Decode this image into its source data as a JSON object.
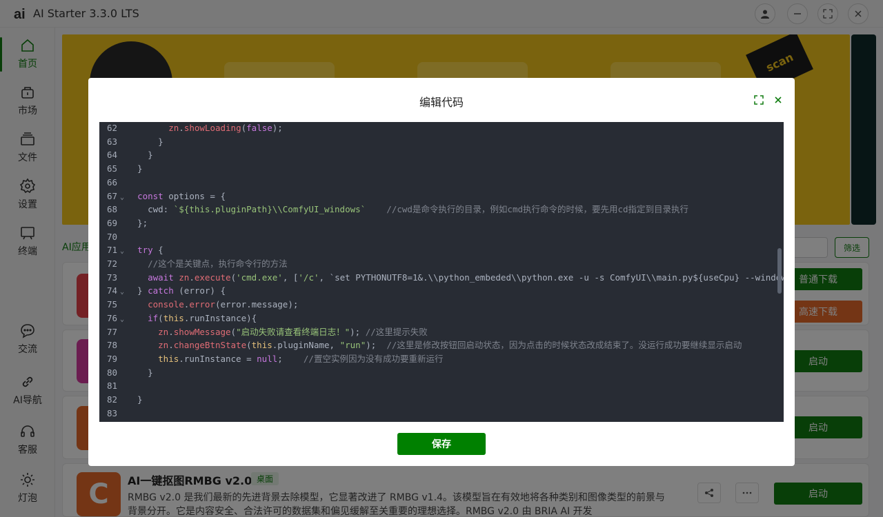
{
  "window": {
    "title": "AI Starter 3.3.0 LTS"
  },
  "sidebar": {
    "items": [
      {
        "label": "首页",
        "icon": "home-icon"
      },
      {
        "label": "市场",
        "icon": "market-icon"
      },
      {
        "label": "文件",
        "icon": "files-icon"
      },
      {
        "label": "设置",
        "icon": "gear-icon"
      },
      {
        "label": "终端",
        "icon": "terminal-icon"
      },
      {
        "label": "交流",
        "icon": "chat-icon"
      },
      {
        "label": "AI导航",
        "icon": "link-icon"
      },
      {
        "label": "客服",
        "icon": "headset-icon"
      },
      {
        "label": "灯泡",
        "icon": "bulb-icon"
      }
    ]
  },
  "main": {
    "banner": {
      "stamp": "scan"
    },
    "tab_label": "AI应用",
    "filter_label": "筛选",
    "buttons": {
      "normal_download": "普通下载",
      "fast_download": "高速下载",
      "start": "启动"
    },
    "app": {
      "name": "AI一键抠图RMBG v2.0",
      "tag": "桌面",
      "description": "RMBG v2.0 是我们最新的先进背景去除模型，它显著改进了 RMBG v1.4。该模型旨在有效地将各种类别和图像类型的前景与背景分开。它是内容安全、合法许可的数据集和偏见缓解至关重要的理想选择。RMBG v2.0 由 BRIA AI 开发",
      "thumb_letter": "C"
    }
  },
  "modal": {
    "title": "编辑代码",
    "save_label": "保存",
    "code_lines": [
      {
        "n": "62",
        "fold": "",
        "ind": "        ",
        "text": "zn.showLoading(false);"
      },
      {
        "n": "63",
        "fold": "",
        "ind": "      ",
        "text": "}"
      },
      {
        "n": "64",
        "fold": "",
        "ind": "    ",
        "text": "}"
      },
      {
        "n": "65",
        "fold": "",
        "ind": "  ",
        "text": "}"
      },
      {
        "n": "66",
        "fold": "",
        "ind": "",
        "text": ""
      },
      {
        "n": "67",
        "fold": "⌄",
        "ind": "  ",
        "text": "const options = {"
      },
      {
        "n": "68",
        "fold": "",
        "ind": "    ",
        "text": "cwd: `${this.pluginPath}\\\\ComfyUI_windows`    //cwd是命令执行的目录，例如cmd执行命令的时候，要先用cd指定到目录执行"
      },
      {
        "n": "69",
        "fold": "",
        "ind": "  ",
        "text": "};"
      },
      {
        "n": "70",
        "fold": "",
        "ind": "",
        "text": ""
      },
      {
        "n": "71",
        "fold": "⌄",
        "ind": "  ",
        "text": "try {"
      },
      {
        "n": "72",
        "fold": "",
        "ind": "    ",
        "text": "//这个是关键点，执行命令行的方法"
      },
      {
        "n": "73",
        "fold": "",
        "ind": "    ",
        "text": "await zn.execute('cmd.exe', ['/c', `set PYTHONUTF8=1&.\\\\python_embeded\\\\python.exe -u -s ComfyUI\\\\main.py${useCpu} --windows-stand"
      },
      {
        "n": "74",
        "fold": "⌄",
        "ind": "  ",
        "text": "} catch (error) {"
      },
      {
        "n": "75",
        "fold": "",
        "ind": "    ",
        "text": "console.error(error.message);"
      },
      {
        "n": "76",
        "fold": "⌄",
        "ind": "    ",
        "text": "if(this.runInstance){"
      },
      {
        "n": "77",
        "fold": "",
        "ind": "      ",
        "text": "zn.showMessage(\"启动失败请查看终端日志！\"); //这里提示失败"
      },
      {
        "n": "78",
        "fold": "",
        "ind": "      ",
        "text": "zn.changeBtnState(this.pluginName, \"run\");  //这里是修改按钮回启动状态，因为点击的时候状态改成结束了。没运行成功要继续显示启动"
      },
      {
        "n": "79",
        "fold": "",
        "ind": "      ",
        "text": "this.runInstance = null;    //置空实例因为没有成功要重新运行"
      },
      {
        "n": "80",
        "fold": "",
        "ind": "    ",
        "text": "}"
      },
      {
        "n": "81",
        "fold": "",
        "ind": "",
        "text": ""
      },
      {
        "n": "82",
        "fold": "",
        "ind": "  ",
        "text": "}"
      },
      {
        "n": "83",
        "fold": "",
        "ind": "",
        "text": ""
      }
    ]
  }
}
